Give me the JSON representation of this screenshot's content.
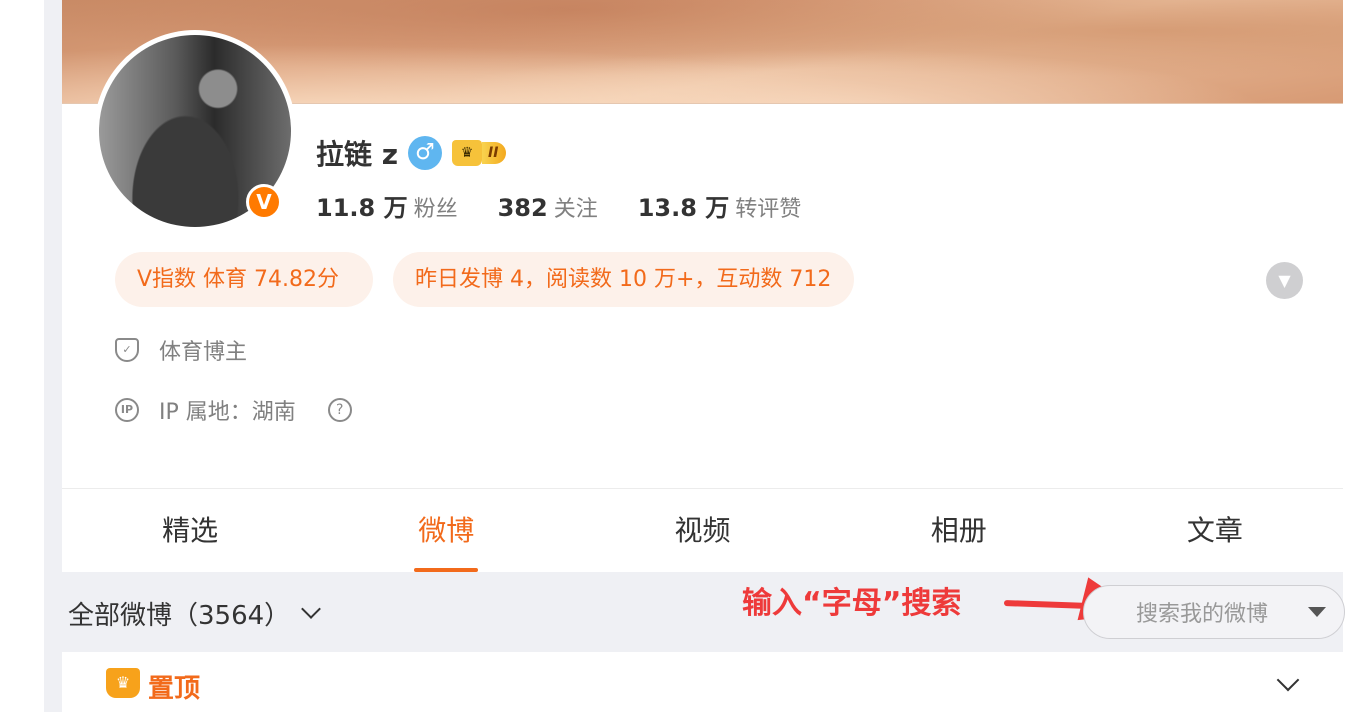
{
  "profile": {
    "name": "拉链 z",
    "gender_symbol": "♂",
    "vip_level": "II",
    "verified_symbol": "V",
    "stats": [
      {
        "value": "11.8 万",
        "label": "粉丝"
      },
      {
        "value": "382",
        "label": "关注"
      },
      {
        "value": "13.8 万",
        "label": "转评赞"
      }
    ]
  },
  "pills": {
    "v_index": "V指数 体育 74.82分",
    "activity": "昨日发博 4，阅读数 10 万+，互动数 712"
  },
  "info": {
    "category": "体育博主",
    "ip_location": "IP 属地：湖南",
    "ip_icon_text": "IP",
    "help_symbol": "?"
  },
  "tabs": [
    "精选",
    "微博",
    "视频",
    "相册",
    "文章"
  ],
  "active_tab": "微博",
  "filter": {
    "label": "全部微博（3564）"
  },
  "annotation": {
    "text": "输入“字母”搜索"
  },
  "search": {
    "placeholder": "搜索我的微博"
  },
  "pinned": {
    "label": "置顶"
  },
  "colors": {
    "accent": "#f26a1b",
    "annotation_red": "#ee3a3a",
    "verified_badge": "#ff7a00",
    "gender_blue": "#5fb6f0"
  }
}
